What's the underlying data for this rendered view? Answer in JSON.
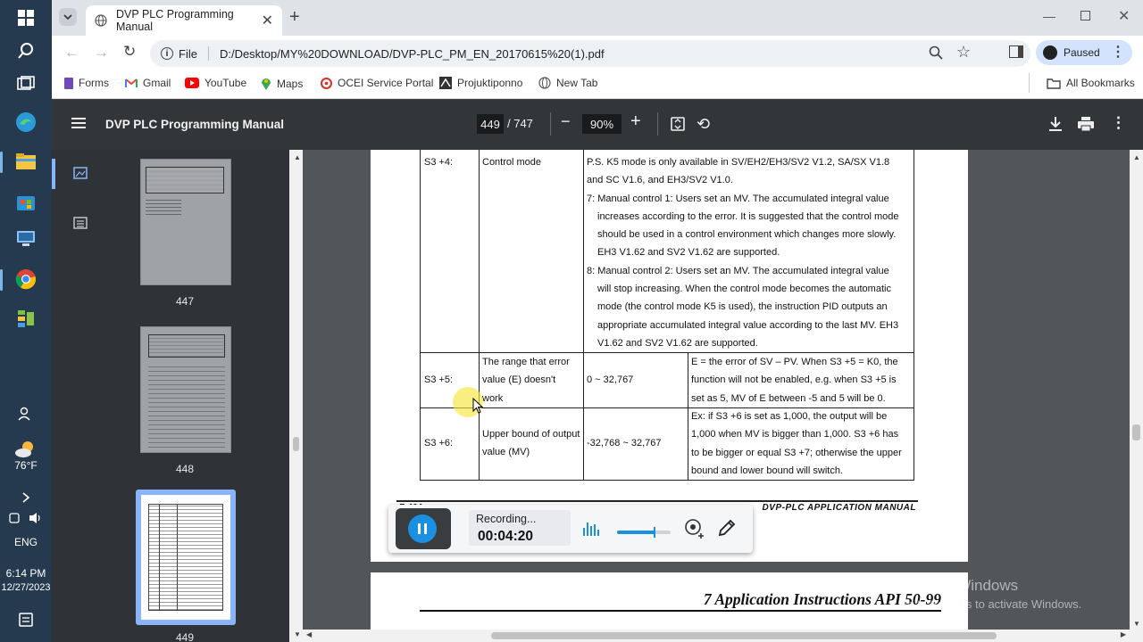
{
  "taskbar": {
    "weather_temp": "76°F",
    "language": "ENG",
    "time": "6:14 PM",
    "date": "12/27/2023"
  },
  "browser": {
    "tab_title": "DVP PLC Programming Manual",
    "file_label": "File",
    "url": "D:/Desktop/MY%20DOWNLOAD/DVP-PLC_PM_EN_20170615%20(1).pdf",
    "profile_status": "Paused",
    "bookmarks": [
      "Forms",
      "Gmail",
      "YouTube",
      "Maps",
      "OCEI Service Portal",
      "Projuktiponno",
      "New Tab"
    ],
    "all_bookmarks": "All Bookmarks"
  },
  "pdf": {
    "title": "DVP PLC Programming Manual",
    "current_page": "449",
    "total_pages": "/ 747",
    "zoom": "90%",
    "thumbnails": [
      "447",
      "448",
      "449"
    ]
  },
  "table": {
    "rows": [
      {
        "param": "S3 +4:",
        "name": "Control mode",
        "range": "",
        "desc_lines": [
          "P.S. K5 mode is only available in SV/EH2/EH3/SV2 V1.2, SA/SX V1.8",
          "and SC V1.6, and EH3/SV2 V1.0.",
          "7: Manual control 1: Users set an MV. The accumulated integral value",
          "increases according to the error. It is suggested that the control mode",
          "should be used in a control environment which changes more slowly.",
          "EH3 V1.62 and SV2 V1.62 are supported.",
          "8: Manual control 2: Users set an MV. The accumulated integral value",
          "will stop increasing. When the control mode becomes the automatic",
          "mode (the control mode K5 is used), the instruction PID outputs an",
          "appropriate accumulated integral value according to the last MV. EH3",
          "V1.62 and SV2 V1.62 are supported."
        ]
      },
      {
        "param": "S3 +5:",
        "name_lines": [
          "The range that error",
          "value (E) doesn't",
          "work"
        ],
        "range": "0 ~ 32,767",
        "desc_lines": [
          "E = the error of SV – PV. When S3 +5 = K0, the",
          "function will not be enabled, e.g. when S3 +5 is",
          "set as 5, MV of E between -5 and 5 will be 0."
        ]
      },
      {
        "param": "S3 +6:",
        "name_lines": [
          "Upper bound of output",
          "value (MV)"
        ],
        "range": "-32,768 ~ 32,767",
        "desc_lines": [
          "Ex: if S3 +6 is set as 1,000, the output will be",
          "1,000 when MV is bigger than 1,000. S3 +6 has",
          "to be bigger or equal S3 +7; otherwise the upper",
          "bound and lower bound will switch."
        ]
      }
    ],
    "footer_left": "7-404",
    "footer_right": "DVP-PLC APPLICATION MANUAL",
    "next_page_heading": "7 Application Instructions API 50-99"
  },
  "recorder": {
    "status": "Recording...",
    "elapsed": "00:04:20"
  },
  "watermark": {
    "title": "Activate Windows",
    "subtitle": "Go to Settings to activate Windows."
  }
}
